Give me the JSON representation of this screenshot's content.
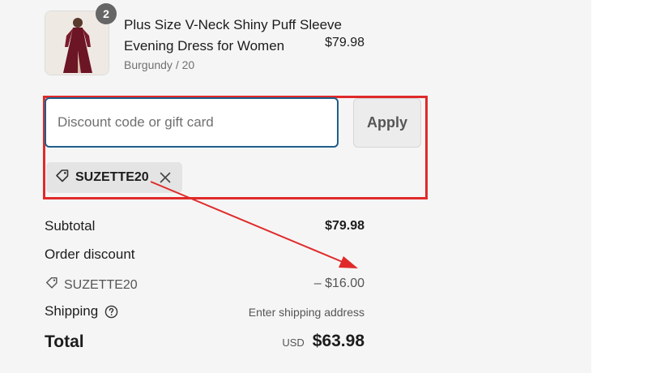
{
  "product": {
    "title": "Plus Size V-Neck Shiny Puff Sleeve Evening Dress for Women",
    "variant": "Burgundy / 20",
    "price": "$79.98",
    "quantity": "2",
    "image_icon": "dress-product-image"
  },
  "discount": {
    "placeholder": "Discount code or gift card",
    "value": "",
    "apply_label": "Apply",
    "applied_code": "SUZETTE20"
  },
  "summary": {
    "subtotal_label": "Subtotal",
    "subtotal_value": "$79.98",
    "order_discount_label": "Order discount",
    "discount_code": "SUZETTE20",
    "discount_amount": "– $16.00",
    "shipping_label": "Shipping",
    "shipping_value": "Enter shipping address",
    "total_label": "Total",
    "currency": "USD",
    "total_value": "$63.98"
  },
  "colors": {
    "annotation_red": "#e02a2a",
    "input_border": "#1f5e8a",
    "panel_bg": "#f5f5f5"
  }
}
